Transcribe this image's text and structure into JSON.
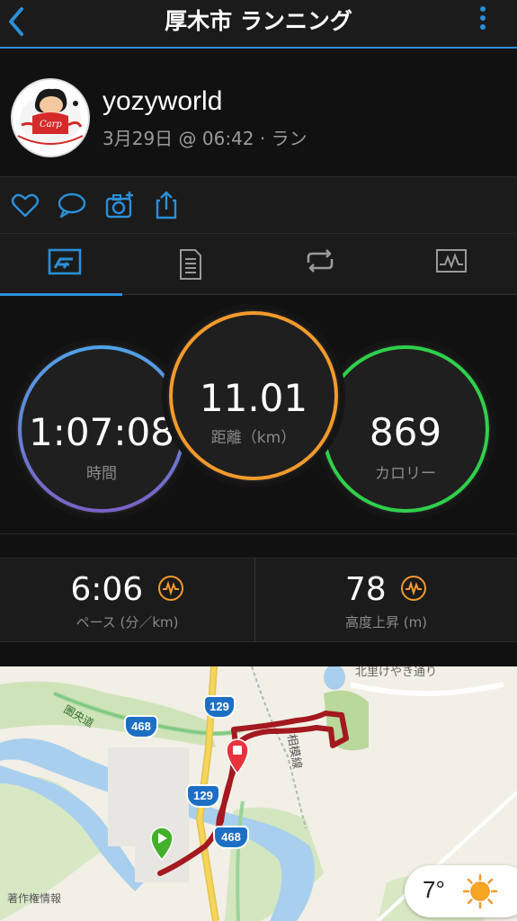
{
  "header": {
    "title": "厚木市 ランニング"
  },
  "profile": {
    "username": "yozyworld",
    "subtitle": "3月29日 @ 06:42 · ラン"
  },
  "stats_circles": {
    "time": {
      "value": "1:07:08",
      "label": "時間"
    },
    "distance": {
      "value": "11.01",
      "label": "距離（km）"
    },
    "calories": {
      "value": "869",
      "label": "カロリー"
    }
  },
  "stats_row": {
    "pace": {
      "value": "6:06",
      "label": "ペース (分／km)"
    },
    "elevation": {
      "value": "78",
      "label": "高度上昇 (m)"
    }
  },
  "map": {
    "credit": "著作権情報",
    "road_labels": {
      "ken_o": "圏央道",
      "sagami": "相模線",
      "kitazato": "北里けやき通り"
    },
    "route_shields": [
      "129",
      "468",
      "129",
      "468"
    ]
  },
  "weather": {
    "temp": "7°"
  },
  "colors": {
    "accent": "#2b8fd8",
    "time_ring": "#5a9fe0",
    "distance_ring": "#f39a2b",
    "calories_ring": "#2fd04a",
    "route": "#a3191f"
  }
}
